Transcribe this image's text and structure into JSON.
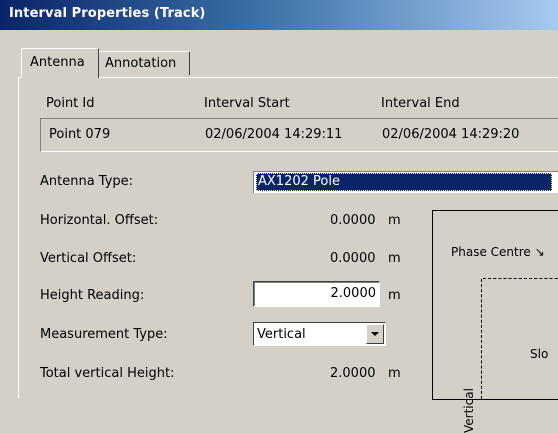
{
  "window": {
    "title": "Interval Properties (Track)"
  },
  "tabs": [
    {
      "label": "Antenna",
      "active": true
    },
    {
      "label": "Annotation",
      "active": false
    }
  ],
  "point_group": {
    "headers": {
      "point_id": "Point Id",
      "interval_start": "Interval Start",
      "interval_end": "Interval End"
    },
    "values": {
      "point_id": "Point 079",
      "interval_start": "02/06/2004 14:29:11",
      "interval_end": "02/06/2004 14:29:20"
    }
  },
  "fields": {
    "antenna_type": {
      "label": "Antenna Type:",
      "value": "AX1202 Pole"
    },
    "horizontal_offset": {
      "label": "Horizontal. Offset:",
      "value": "0.0000",
      "unit": "m"
    },
    "vertical_offset": {
      "label": "Vertical Offset:",
      "value": "0.0000",
      "unit": "m"
    },
    "height_reading": {
      "label": "Height Reading:",
      "value": "2.0000",
      "unit": "m"
    },
    "measurement_type": {
      "label": "Measurement Type:",
      "value": "Vertical"
    },
    "total_vertical_height": {
      "label": "Total vertical Height:",
      "value": "2.0000",
      "unit": "m"
    }
  },
  "diagram": {
    "phase_centre_label": "Phase Centre",
    "vertical_label": "Vertical",
    "slope_label": "Slo"
  },
  "colors": {
    "title_gradient_start": "#0a246a",
    "title_gradient_end": "#a6caf0",
    "dialog_face": "#d4d0c8",
    "selection": "#0a246a"
  }
}
